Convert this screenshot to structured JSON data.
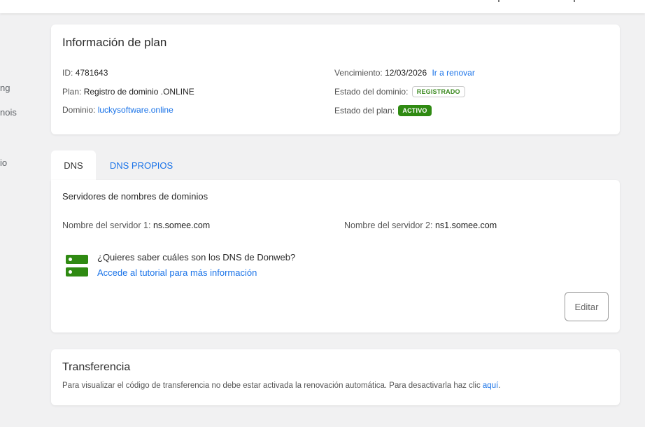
{
  "sidebar": {
    "items": [
      {
        "label": "ng"
      },
      {
        "label": "nois"
      },
      {
        "label": "io"
      }
    ]
  },
  "plan": {
    "title": "Información de plan",
    "id_label": "ID:",
    "id_value": "4781643",
    "plan_label": "Plan:",
    "plan_value": "Registro de dominio .ONLINE",
    "domain_label": "Dominio:",
    "domain_value": "luckysoftware.online",
    "expiry_label": "Vencimiento:",
    "expiry_value": "12/03/2026",
    "renew_link": "Ir a renovar",
    "domain_status_label": "Estado del dominio:",
    "domain_status_value": "REGISTRADO",
    "plan_status_label": "Estado del plan:",
    "plan_status_value": "ACTIVO"
  },
  "tabs": [
    {
      "label": "DNS"
    },
    {
      "label": "DNS PROPIOS"
    }
  ],
  "dns": {
    "title": "Servidores de nombres de dominios",
    "server1_label": "Nombre del servidor 1:",
    "server1_value": "ns.somee.com",
    "server2_label": "Nombre del servidor 2:",
    "server2_value": "ns1.somee.com",
    "help_question": "¿Quieres saber cuáles son los DNS de Donweb?",
    "help_link": "Accede al tutorial para más información",
    "edit_button": "Editar"
  },
  "transfer": {
    "title": "Transferencia",
    "text": "Para visualizar el código de transferencia no debe estar activada la renovación automática. Para desactivarla haz clic",
    "link": "aquí",
    "period": "."
  },
  "icons": {
    "server": "server-icon"
  },
  "colors": {
    "accent": "#1a73e8",
    "success": "#2f8a12",
    "background": "#f1f1f2"
  }
}
